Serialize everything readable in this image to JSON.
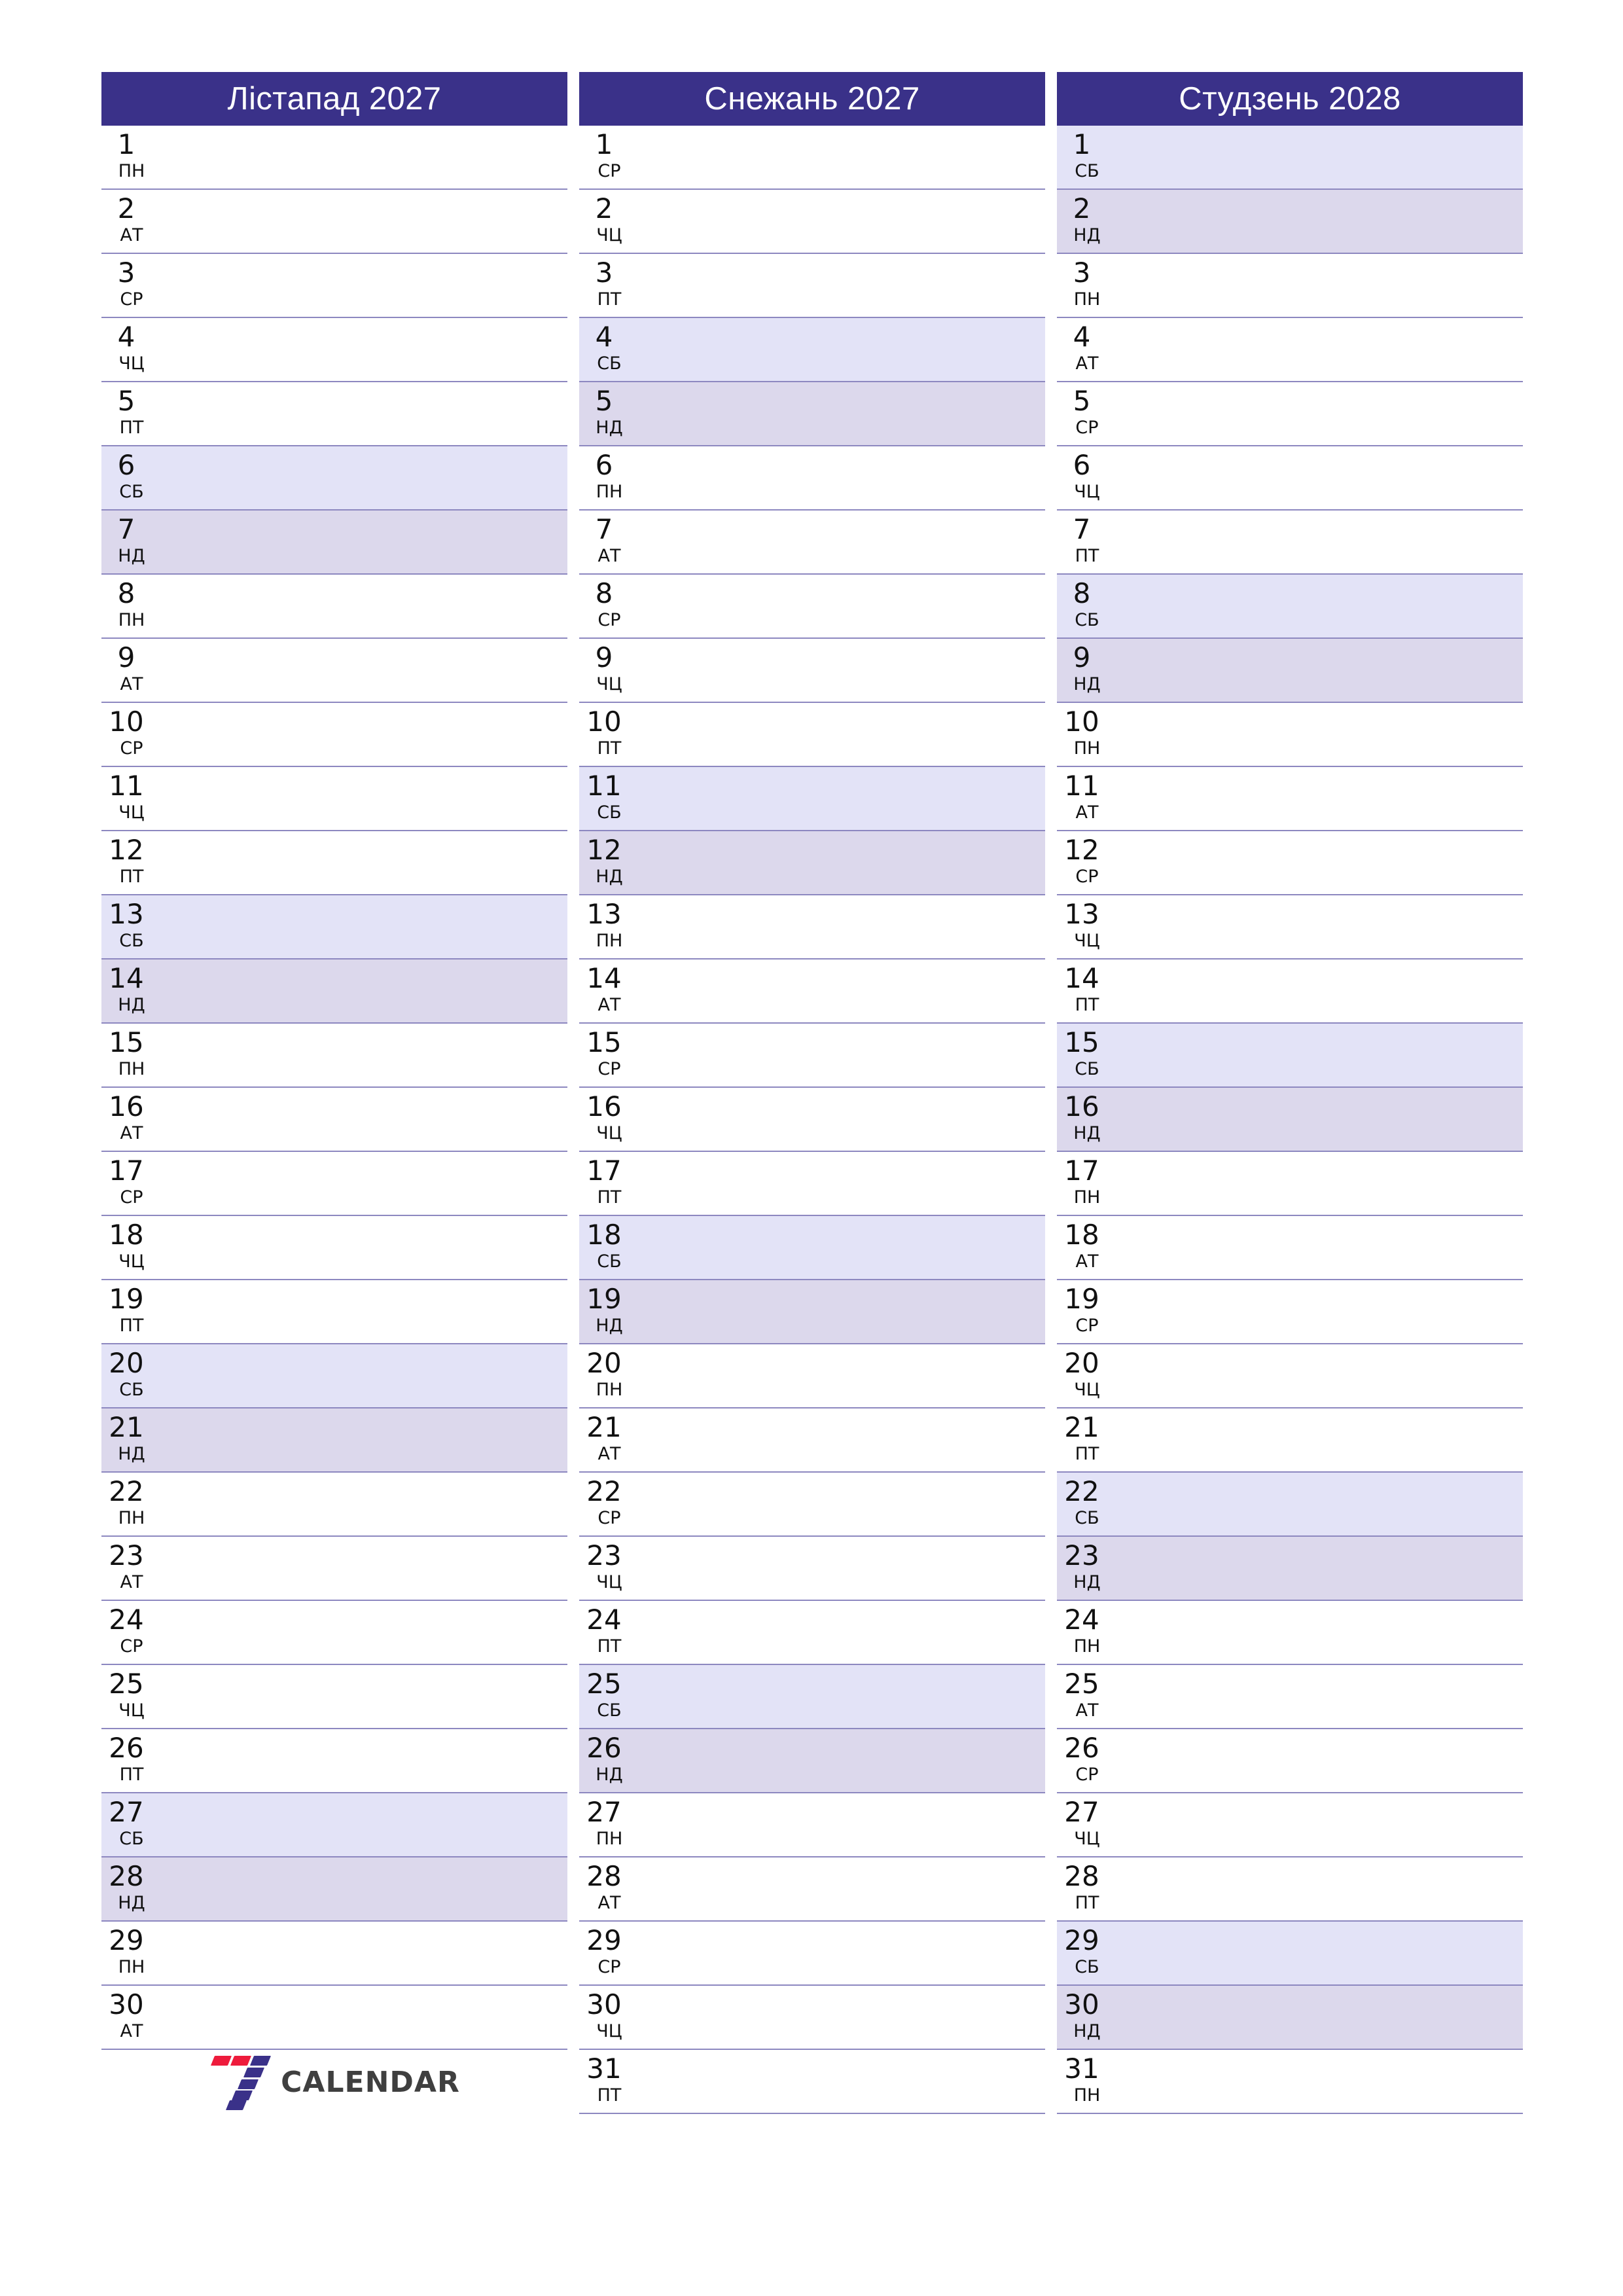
{
  "page": {
    "type": "printable-monthly-planner",
    "background_color": "#ffffff",
    "columns_count": 3
  },
  "theme": {
    "header_bg": "#3a3189",
    "header_text": "#ffffff",
    "saturday_bg": "#e3e3f7",
    "sunday_bg": "#dcd8ec",
    "row_border": "#8d88c0",
    "day_text": "#111111",
    "logo_accent_red": "#ee1b3c",
    "logo_accent_indigo": "#3a3189",
    "logo_word_color": "#3f3f3f"
  },
  "weekday_labels": {
    "mon": "ПН",
    "tue": "АТ",
    "wed": "СР",
    "thu": "ЧЦ",
    "fri": "ПТ",
    "sat": "СБ",
    "sun": "НД"
  },
  "logo": {
    "word": "CALENDAR",
    "mark": "seven-mark"
  },
  "months": [
    {
      "title": "Лістапад 2027",
      "days": [
        {
          "num": "1",
          "dow": "ПН",
          "kind": "weekday"
        },
        {
          "num": "2",
          "dow": "АТ",
          "kind": "weekday"
        },
        {
          "num": "3",
          "dow": "СР",
          "kind": "weekday"
        },
        {
          "num": "4",
          "dow": "ЧЦ",
          "kind": "weekday"
        },
        {
          "num": "5",
          "dow": "ПТ",
          "kind": "weekday"
        },
        {
          "num": "6",
          "dow": "СБ",
          "kind": "sat"
        },
        {
          "num": "7",
          "dow": "НД",
          "kind": "sun"
        },
        {
          "num": "8",
          "dow": "ПН",
          "kind": "weekday"
        },
        {
          "num": "9",
          "dow": "АТ",
          "kind": "weekday"
        },
        {
          "num": "10",
          "dow": "СР",
          "kind": "weekday"
        },
        {
          "num": "11",
          "dow": "ЧЦ",
          "kind": "weekday"
        },
        {
          "num": "12",
          "dow": "ПТ",
          "kind": "weekday"
        },
        {
          "num": "13",
          "dow": "СБ",
          "kind": "sat"
        },
        {
          "num": "14",
          "dow": "НД",
          "kind": "sun"
        },
        {
          "num": "15",
          "dow": "ПН",
          "kind": "weekday"
        },
        {
          "num": "16",
          "dow": "АТ",
          "kind": "weekday"
        },
        {
          "num": "17",
          "dow": "СР",
          "kind": "weekday"
        },
        {
          "num": "18",
          "dow": "ЧЦ",
          "kind": "weekday"
        },
        {
          "num": "19",
          "dow": "ПТ",
          "kind": "weekday"
        },
        {
          "num": "20",
          "dow": "СБ",
          "kind": "sat"
        },
        {
          "num": "21",
          "dow": "НД",
          "kind": "sun"
        },
        {
          "num": "22",
          "dow": "ПН",
          "kind": "weekday"
        },
        {
          "num": "23",
          "dow": "АТ",
          "kind": "weekday"
        },
        {
          "num": "24",
          "dow": "СР",
          "kind": "weekday"
        },
        {
          "num": "25",
          "dow": "ЧЦ",
          "kind": "weekday"
        },
        {
          "num": "26",
          "dow": "ПТ",
          "kind": "weekday"
        },
        {
          "num": "27",
          "dow": "СБ",
          "kind": "sat"
        },
        {
          "num": "28",
          "dow": "НД",
          "kind": "sun"
        },
        {
          "num": "29",
          "dow": "ПН",
          "kind": "weekday"
        },
        {
          "num": "30",
          "dow": "АТ",
          "kind": "weekday"
        }
      ],
      "has_logo": true
    },
    {
      "title": "Снежань 2027",
      "days": [
        {
          "num": "1",
          "dow": "СР",
          "kind": "weekday"
        },
        {
          "num": "2",
          "dow": "ЧЦ",
          "kind": "weekday"
        },
        {
          "num": "3",
          "dow": "ПТ",
          "kind": "weekday"
        },
        {
          "num": "4",
          "dow": "СБ",
          "kind": "sat"
        },
        {
          "num": "5",
          "dow": "НД",
          "kind": "sun"
        },
        {
          "num": "6",
          "dow": "ПН",
          "kind": "weekday"
        },
        {
          "num": "7",
          "dow": "АТ",
          "kind": "weekday"
        },
        {
          "num": "8",
          "dow": "СР",
          "kind": "weekday"
        },
        {
          "num": "9",
          "dow": "ЧЦ",
          "kind": "weekday"
        },
        {
          "num": "10",
          "dow": "ПТ",
          "kind": "weekday"
        },
        {
          "num": "11",
          "dow": "СБ",
          "kind": "sat"
        },
        {
          "num": "12",
          "dow": "НД",
          "kind": "sun"
        },
        {
          "num": "13",
          "dow": "ПН",
          "kind": "weekday"
        },
        {
          "num": "14",
          "dow": "АТ",
          "kind": "weekday"
        },
        {
          "num": "15",
          "dow": "СР",
          "kind": "weekday"
        },
        {
          "num": "16",
          "dow": "ЧЦ",
          "kind": "weekday"
        },
        {
          "num": "17",
          "dow": "ПТ",
          "kind": "weekday"
        },
        {
          "num": "18",
          "dow": "СБ",
          "kind": "sat"
        },
        {
          "num": "19",
          "dow": "НД",
          "kind": "sun"
        },
        {
          "num": "20",
          "dow": "ПН",
          "kind": "weekday"
        },
        {
          "num": "21",
          "dow": "АТ",
          "kind": "weekday"
        },
        {
          "num": "22",
          "dow": "СР",
          "kind": "weekday"
        },
        {
          "num": "23",
          "dow": "ЧЦ",
          "kind": "weekday"
        },
        {
          "num": "24",
          "dow": "ПТ",
          "kind": "weekday"
        },
        {
          "num": "25",
          "dow": "СБ",
          "kind": "sat"
        },
        {
          "num": "26",
          "dow": "НД",
          "kind": "sun"
        },
        {
          "num": "27",
          "dow": "ПН",
          "kind": "weekday"
        },
        {
          "num": "28",
          "dow": "АТ",
          "kind": "weekday"
        },
        {
          "num": "29",
          "dow": "СР",
          "kind": "weekday"
        },
        {
          "num": "30",
          "dow": "ЧЦ",
          "kind": "weekday"
        },
        {
          "num": "31",
          "dow": "ПТ",
          "kind": "weekday"
        }
      ],
      "has_logo": false
    },
    {
      "title": "Студзень 2028",
      "days": [
        {
          "num": "1",
          "dow": "СБ",
          "kind": "sat"
        },
        {
          "num": "2",
          "dow": "НД",
          "kind": "sun"
        },
        {
          "num": "3",
          "dow": "ПН",
          "kind": "weekday"
        },
        {
          "num": "4",
          "dow": "АТ",
          "kind": "weekday"
        },
        {
          "num": "5",
          "dow": "СР",
          "kind": "weekday"
        },
        {
          "num": "6",
          "dow": "ЧЦ",
          "kind": "weekday"
        },
        {
          "num": "7",
          "dow": "ПТ",
          "kind": "weekday"
        },
        {
          "num": "8",
          "dow": "СБ",
          "kind": "sat"
        },
        {
          "num": "9",
          "dow": "НД",
          "kind": "sun"
        },
        {
          "num": "10",
          "dow": "ПН",
          "kind": "weekday"
        },
        {
          "num": "11",
          "dow": "АТ",
          "kind": "weekday"
        },
        {
          "num": "12",
          "dow": "СР",
          "kind": "weekday"
        },
        {
          "num": "13",
          "dow": "ЧЦ",
          "kind": "weekday"
        },
        {
          "num": "14",
          "dow": "ПТ",
          "kind": "weekday"
        },
        {
          "num": "15",
          "dow": "СБ",
          "kind": "sat"
        },
        {
          "num": "16",
          "dow": "НД",
          "kind": "sun"
        },
        {
          "num": "17",
          "dow": "ПН",
          "kind": "weekday"
        },
        {
          "num": "18",
          "dow": "АТ",
          "kind": "weekday"
        },
        {
          "num": "19",
          "dow": "СР",
          "kind": "weekday"
        },
        {
          "num": "20",
          "dow": "ЧЦ",
          "kind": "weekday"
        },
        {
          "num": "21",
          "dow": "ПТ",
          "kind": "weekday"
        },
        {
          "num": "22",
          "dow": "СБ",
          "kind": "sat"
        },
        {
          "num": "23",
          "dow": "НД",
          "kind": "sun"
        },
        {
          "num": "24",
          "dow": "ПН",
          "kind": "weekday"
        },
        {
          "num": "25",
          "dow": "АТ",
          "kind": "weekday"
        },
        {
          "num": "26",
          "dow": "СР",
          "kind": "weekday"
        },
        {
          "num": "27",
          "dow": "ЧЦ",
          "kind": "weekday"
        },
        {
          "num": "28",
          "dow": "ПТ",
          "kind": "weekday"
        },
        {
          "num": "29",
          "dow": "СБ",
          "kind": "sat"
        },
        {
          "num": "30",
          "dow": "НД",
          "kind": "sun"
        },
        {
          "num": "31",
          "dow": "ПН",
          "kind": "weekday"
        }
      ],
      "has_logo": false
    }
  ]
}
